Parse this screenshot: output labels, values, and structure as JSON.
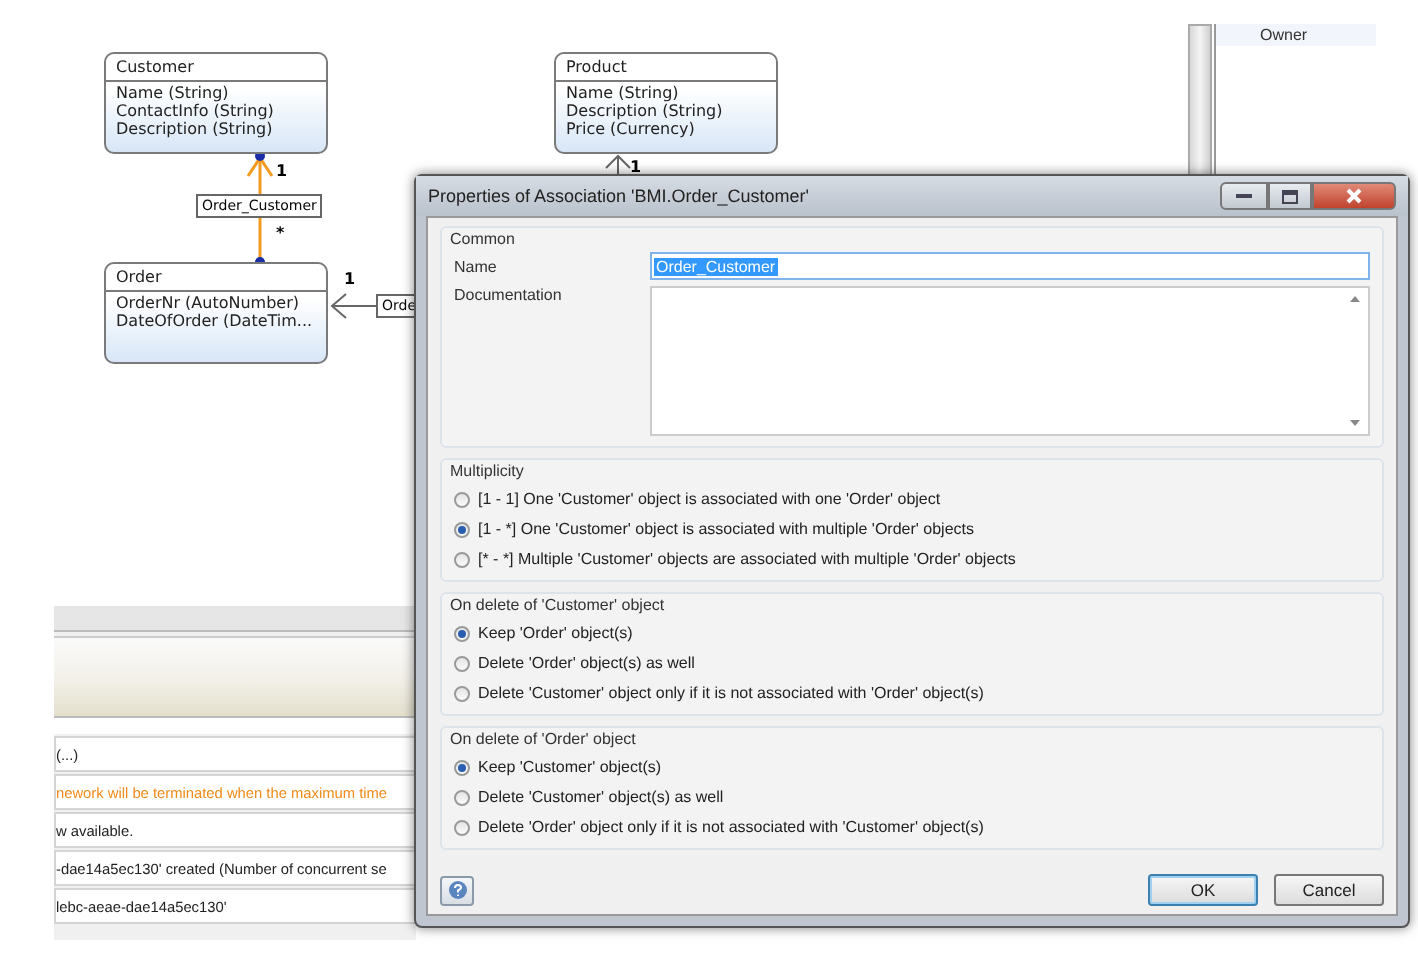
{
  "diagram": {
    "entities": [
      {
        "name": "Customer",
        "attributes": [
          "Name (String)",
          "ContactInfo (String)",
          "Description (String)"
        ]
      },
      {
        "name": "Product",
        "attributes": [
          "Name (String)",
          "Description (String)",
          "Price (Currency)"
        ]
      },
      {
        "name": "Order",
        "attributes": [
          "OrderNr (AutoNumber)",
          "DateOfOrder (DateTim..."
        ]
      }
    ],
    "associations": [
      {
        "label": "Order_Customer",
        "selected": true,
        "multiplicities": [
          "1",
          "*"
        ]
      },
      {
        "label": "Orde",
        "selected": false,
        "multiplicities": [
          "1"
        ]
      },
      {
        "selected": false,
        "multiplicities": [
          "1"
        ]
      }
    ]
  },
  "side_panel": {
    "items": [
      "Owner"
    ]
  },
  "output_log": {
    "rows": [
      {
        "text": "(...)",
        "kind": "info"
      },
      {
        "text": "nework will be terminated when the maximum time",
        "kind": "warning"
      },
      {
        "text": "w available.",
        "kind": "info"
      },
      {
        "text": "-dae14a5ec130' created (Number of concurrent se",
        "kind": "info"
      },
      {
        "text": "lebc-aeae-dae14a5ec130'",
        "kind": "info"
      }
    ]
  },
  "dialog": {
    "title": "Properties of Association 'BMI.Order_Customer'",
    "common": {
      "legend": "Common",
      "name_label": "Name",
      "name_value": "Order_Customer",
      "documentation_label": "Documentation"
    },
    "groups": [
      {
        "legend": "Multiplicity",
        "options": [
          {
            "label": "[1 - 1] One 'Customer' object is associated with one 'Order' object",
            "selected": false
          },
          {
            "label": "[1 - *] One 'Customer' object is associated with multiple 'Order' objects",
            "selected": true
          },
          {
            "label": "[* - *] Multiple 'Customer' objects are associated with multiple 'Order' objects",
            "selected": false
          }
        ]
      },
      {
        "legend": "On delete of 'Customer' object",
        "options": [
          {
            "label": "Keep 'Order' object(s)",
            "selected": true
          },
          {
            "label": "Delete 'Order' object(s) as well",
            "selected": false
          },
          {
            "label": "Delete 'Customer' object only if it is not associated with 'Order' object(s)",
            "selected": false
          }
        ]
      },
      {
        "legend": "On delete of 'Order' object",
        "options": [
          {
            "label": "Keep 'Customer' object(s)",
            "selected": true
          },
          {
            "label": "Delete 'Customer' object(s) as well",
            "selected": false
          },
          {
            "label": "Delete 'Order' object only if it is not associated with 'Customer' object(s)",
            "selected": false
          }
        ]
      }
    ],
    "buttons": [
      "OK",
      "Cancel"
    ]
  }
}
